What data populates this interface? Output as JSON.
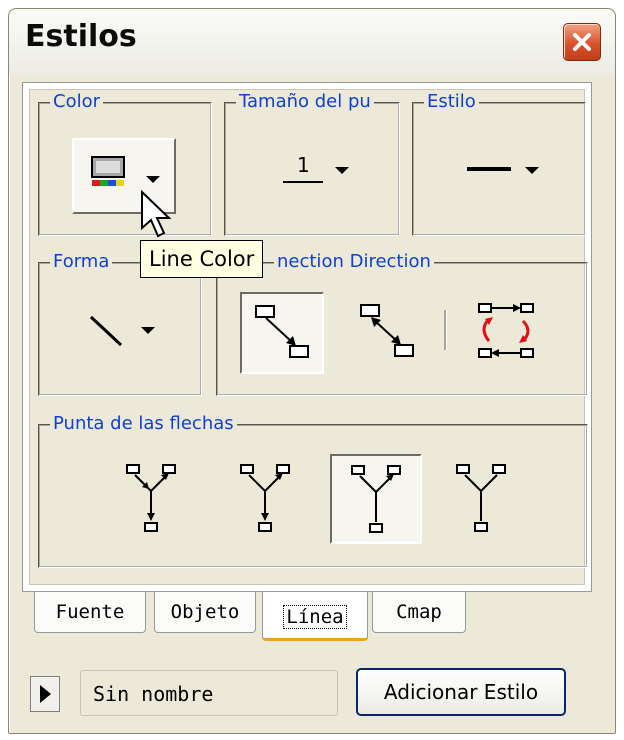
{
  "window": {
    "title": "Estilos"
  },
  "groups": {
    "color": "Color",
    "size": "Tamaño del pu",
    "style": "Estilo",
    "shape": "Forma",
    "connection": "nection Direction",
    "arrowheads": "Punta de las flechas"
  },
  "controls": {
    "size_value": "1"
  },
  "tooltip": "Line Color",
  "tabs": [
    {
      "label": "Fuente"
    },
    {
      "label": "Objeto"
    },
    {
      "label": "Línea",
      "active": true
    },
    {
      "label": "Cmap"
    }
  ],
  "footer": {
    "style_name": "Sin nombre",
    "add_button": "Adicionar Estilo"
  },
  "icons": [
    "close-icon",
    "line-color-icon",
    "dropdown-arrow-icon",
    "line-style-icon",
    "line-shape-icon",
    "connection-direction-icon",
    "arrowhead-icon",
    "cursor-icon",
    "play-icon"
  ],
  "colors": {
    "legend_text": "#0f3fd4",
    "tab_active_underline": "#f0a020",
    "close_button": "#d9532c"
  }
}
